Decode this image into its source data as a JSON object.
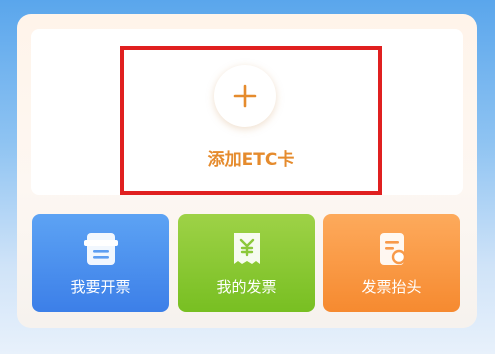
{
  "add_card": {
    "label": "添加ETC卡",
    "icon": "plus-icon"
  },
  "actions": [
    {
      "label": "我要开票",
      "icon": "invoice-icon",
      "color": "#3c7fe8"
    },
    {
      "label": "我的发票",
      "icon": "yuan-receipt-icon",
      "color": "#78bf22"
    },
    {
      "label": "发票抬头",
      "icon": "invoice-title-icon",
      "color": "#f68a30"
    }
  ],
  "colors": {
    "accent": "#e58b2d",
    "highlight": "#e02020"
  }
}
